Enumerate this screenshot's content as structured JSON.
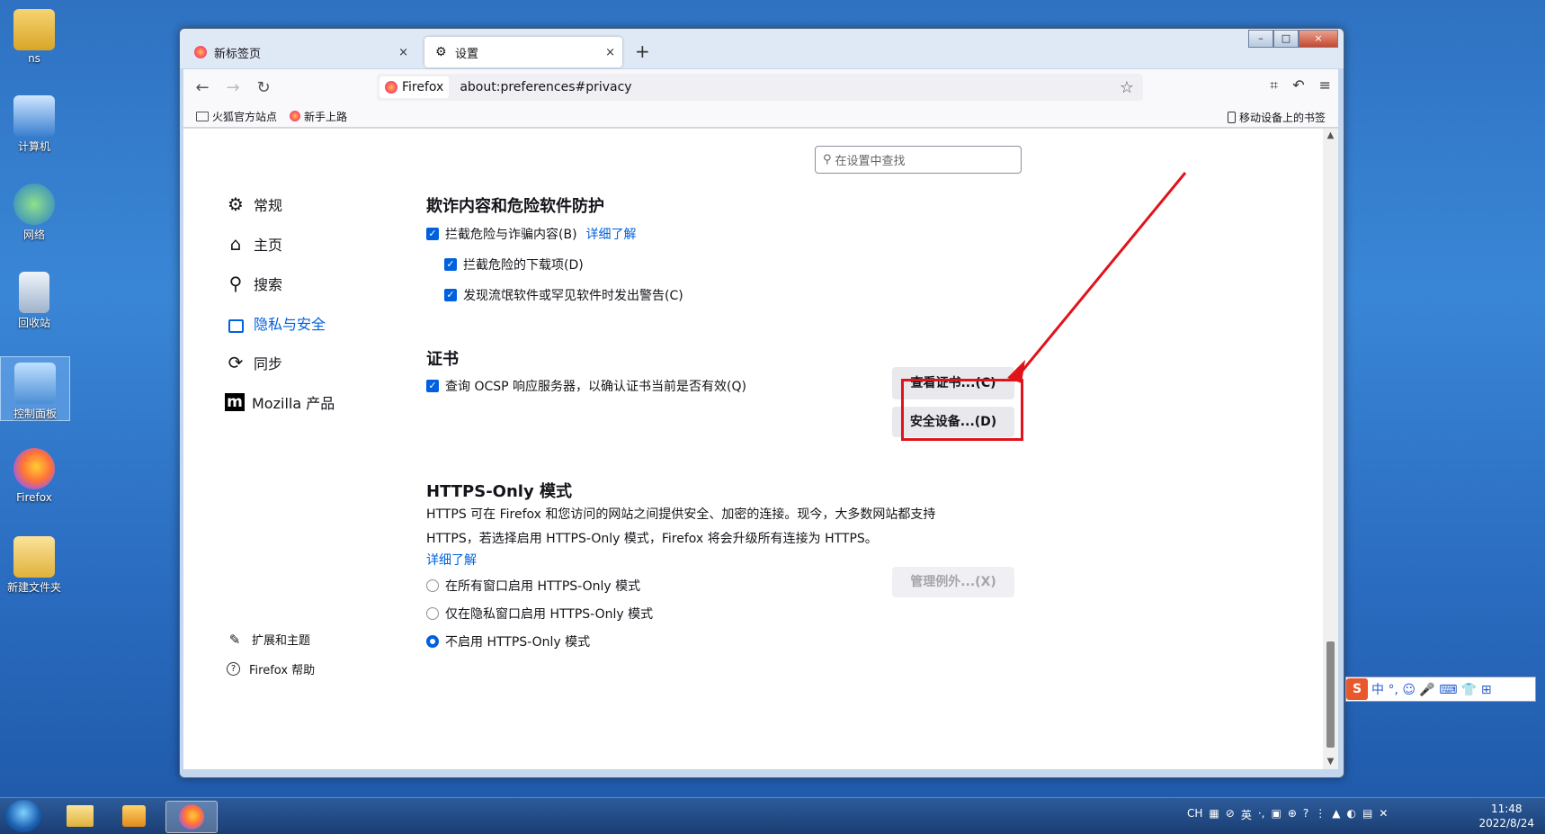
{
  "desktop": {
    "icons": [
      {
        "label": "ns"
      },
      {
        "label": "计算机"
      },
      {
        "label": "网络"
      },
      {
        "label": "回收站"
      },
      {
        "label": "控制面板"
      },
      {
        "label": "Firefox"
      },
      {
        "label": "新建文件夹"
      }
    ]
  },
  "window": {
    "tabs": [
      {
        "label": "新标签页",
        "close": "×"
      },
      {
        "label": "设置",
        "close": "×"
      }
    ],
    "new_tab": "+",
    "controls": {
      "minimize": "–",
      "maximize": "□",
      "close": "×"
    }
  },
  "navbar": {
    "back": "←",
    "forward": "→",
    "reload": "↻",
    "identity": "Firefox",
    "url": "about:preferences#privacy",
    "star": "☆",
    "right_icons": [
      "⌗",
      "↶",
      "≡"
    ]
  },
  "bookmarks": {
    "items": [
      {
        "label": "火狐官方站点"
      },
      {
        "label": "新手上路"
      }
    ],
    "mobile": "移动设备上的书签"
  },
  "search": {
    "placeholder": "在设置中查找"
  },
  "sidebar": {
    "items": [
      {
        "label": "常规",
        "icon": "⚙"
      },
      {
        "label": "主页",
        "icon": "⌂"
      },
      {
        "label": "搜索",
        "icon": "⚲"
      },
      {
        "label": "隐私与安全",
        "icon": "🔒"
      },
      {
        "label": "同步",
        "icon": "⟳"
      },
      {
        "label": "Mozilla 产品",
        "icon": "m"
      }
    ],
    "bottom": [
      {
        "label": "扩展和主题",
        "icon": "✎"
      },
      {
        "label": "Firefox 帮助",
        "icon": "?"
      }
    ]
  },
  "fraud": {
    "title": "欺诈内容和危险软件防护",
    "block_dangerous": "拦截危险与诈骗内容(B)",
    "learn_more": "详细了解",
    "block_downloads": "拦截危险的下载项(D)",
    "warn_unwanted": "发现流氓软件或罕见软件时发出警告(C)"
  },
  "certs": {
    "title": "证书",
    "ocsp": "查询 OCSP 响应服务器，以确认证书当前是否有效(Q)",
    "view_button": "查看证书...(C)",
    "devices_button": "安全设备...(D)"
  },
  "https": {
    "title": "HTTPS-Only 模式",
    "desc1": "HTTPS 可在 Firefox 和您访问的网站之间提供安全、加密的连接。现今，大多数网站都支持",
    "desc2": "HTTPS，若选择启用 HTTPS-Only 模式，Firefox 将会升级所有连接为 HTTPS。",
    "learn_more": "详细了解",
    "opt_all": "在所有窗口启用 HTTPS-Only 模式",
    "opt_private": "仅在隐私窗口启用 HTTPS-Only 模式",
    "opt_off": "不启用 HTTPS-Only 模式",
    "exceptions_button": "管理例外...(X)"
  },
  "ime": {
    "logo": "S",
    "text": "中 °, ☺ 🎤 ⌨ 👕 ⊞"
  },
  "taskbar": {
    "tray_text": "CH",
    "time": "11:48",
    "date": "2022/8/24"
  },
  "colors": {
    "accent": "#0061e0",
    "annotation": "#e0131b"
  }
}
